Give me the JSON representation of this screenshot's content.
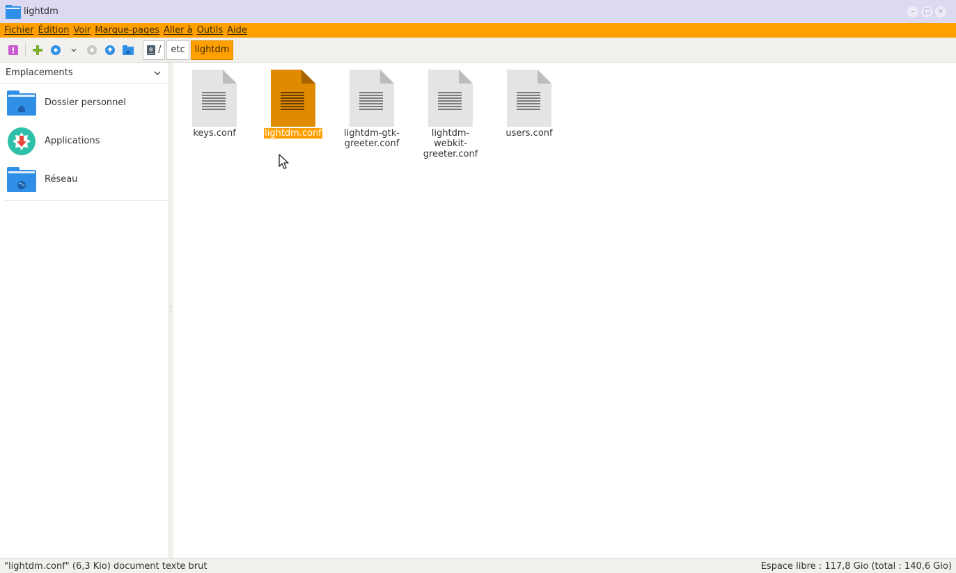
{
  "window": {
    "title": "lightdm",
    "controls": {
      "minimize": "–",
      "maximize": "□",
      "close": "×"
    }
  },
  "menubar": [
    "Fichier",
    "Édition",
    "Voir",
    "Marque-pages",
    "Aller à",
    "Outils",
    "Aide"
  ],
  "toolbar": {
    "buttons": [
      "new-tab-icon",
      "add-icon",
      "back-icon",
      "history-dropdown-icon",
      "forward-icon",
      "up-icon",
      "home-icon"
    ]
  },
  "path": {
    "root_separator": "/",
    "crumbs": [
      "etc",
      "lightdm"
    ],
    "active": "lightdm"
  },
  "sidebar": {
    "header": "Emplacements",
    "items": [
      {
        "label": "Dossier personnel",
        "icon": "home-folder-icon"
      },
      {
        "label": "Applications",
        "icon": "applications-icon"
      },
      {
        "label": "Réseau",
        "icon": "network-folder-icon"
      }
    ]
  },
  "files": [
    {
      "name": "keys.conf",
      "selected": false
    },
    {
      "name": "lightdm.conf",
      "selected": true
    },
    {
      "name": "lightdm-gtk-greeter.conf",
      "selected": false
    },
    {
      "name": "lightdm-webkit-greeter.conf",
      "selected": false
    },
    {
      "name": "users.conf",
      "selected": false
    }
  ],
  "status": {
    "left": "\"lightdm.conf\" (6,3 Kio) document texte brut",
    "right": "Espace libre : 117,8 Gio (total : 140,6 Gio)"
  },
  "colors": {
    "accent": "#ff9f00",
    "titlebar": "#dcdaf0",
    "folder_blue": "#2f8fe6"
  }
}
